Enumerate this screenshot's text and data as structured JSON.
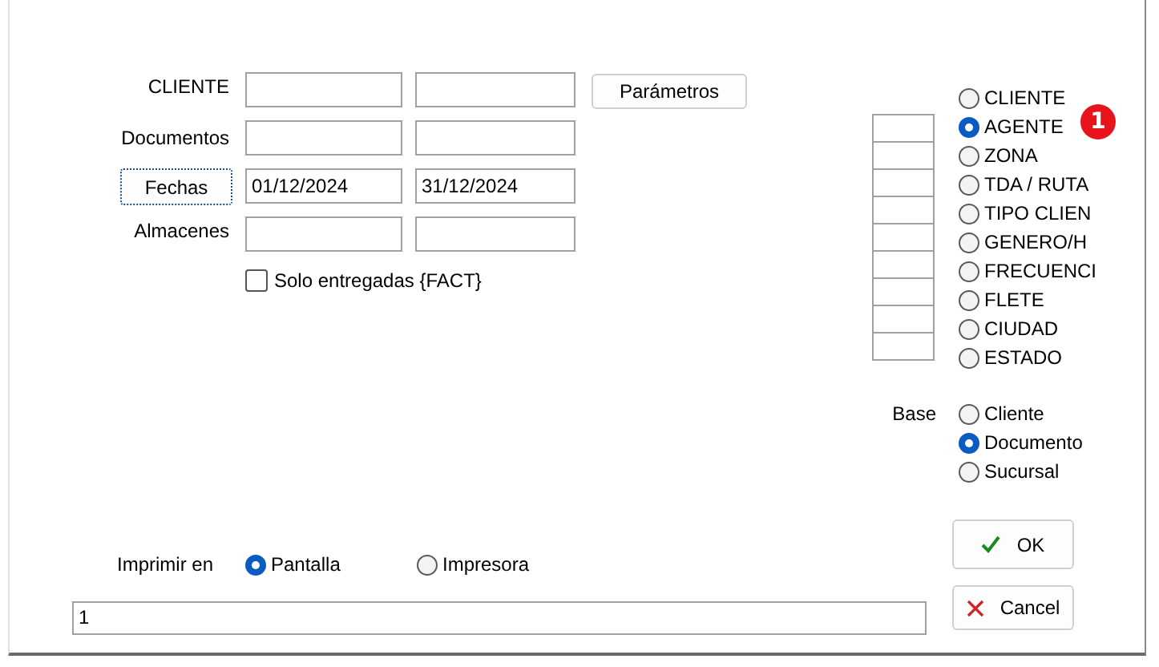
{
  "form": {
    "rows": [
      {
        "label": "CLIENTE",
        "kind": "label"
      },
      {
        "label": "Documentos",
        "kind": "label"
      },
      {
        "label": "Fechas",
        "kind": "button",
        "from": "01/12/2024",
        "to": "31/12/2024"
      },
      {
        "label": "Almacenes",
        "kind": "label"
      }
    ],
    "parameters_button": "Parámetros",
    "delivered_only": {
      "label": "Solo entregadas {FACT}",
      "checked": false
    }
  },
  "group_by": [
    {
      "label": "CLIENTE",
      "selected": false
    },
    {
      "label": "AGENTE",
      "selected": true
    },
    {
      "label": "ZONA",
      "selected": false
    },
    {
      "label": "TDA / RUTA",
      "selected": false
    },
    {
      "label": "TIPO CLIEN",
      "selected": false
    },
    {
      "label": "GENERO/H",
      "selected": false
    },
    {
      "label": "FRECUENCI",
      "selected": false
    },
    {
      "label": "FLETE",
      "selected": false
    },
    {
      "label": "CIUDAD",
      "selected": false
    },
    {
      "label": "ESTADO",
      "selected": false
    }
  ],
  "badge": "1",
  "base": {
    "label": "Base",
    "options": [
      {
        "label": "Cliente",
        "selected": false
      },
      {
        "label": "Documento",
        "selected": true
      },
      {
        "label": "Sucursal",
        "selected": false
      }
    ]
  },
  "print_to": {
    "label": "Imprimir en",
    "options": [
      {
        "label": "Pantalla",
        "selected": true
      },
      {
        "label": "Impresora",
        "selected": false
      }
    ]
  },
  "output_field": {
    "value": "1"
  },
  "buttons": [
    {
      "label": "OK",
      "kind": "ok"
    },
    {
      "label": "Cancel",
      "kind": "cancel"
    }
  ]
}
